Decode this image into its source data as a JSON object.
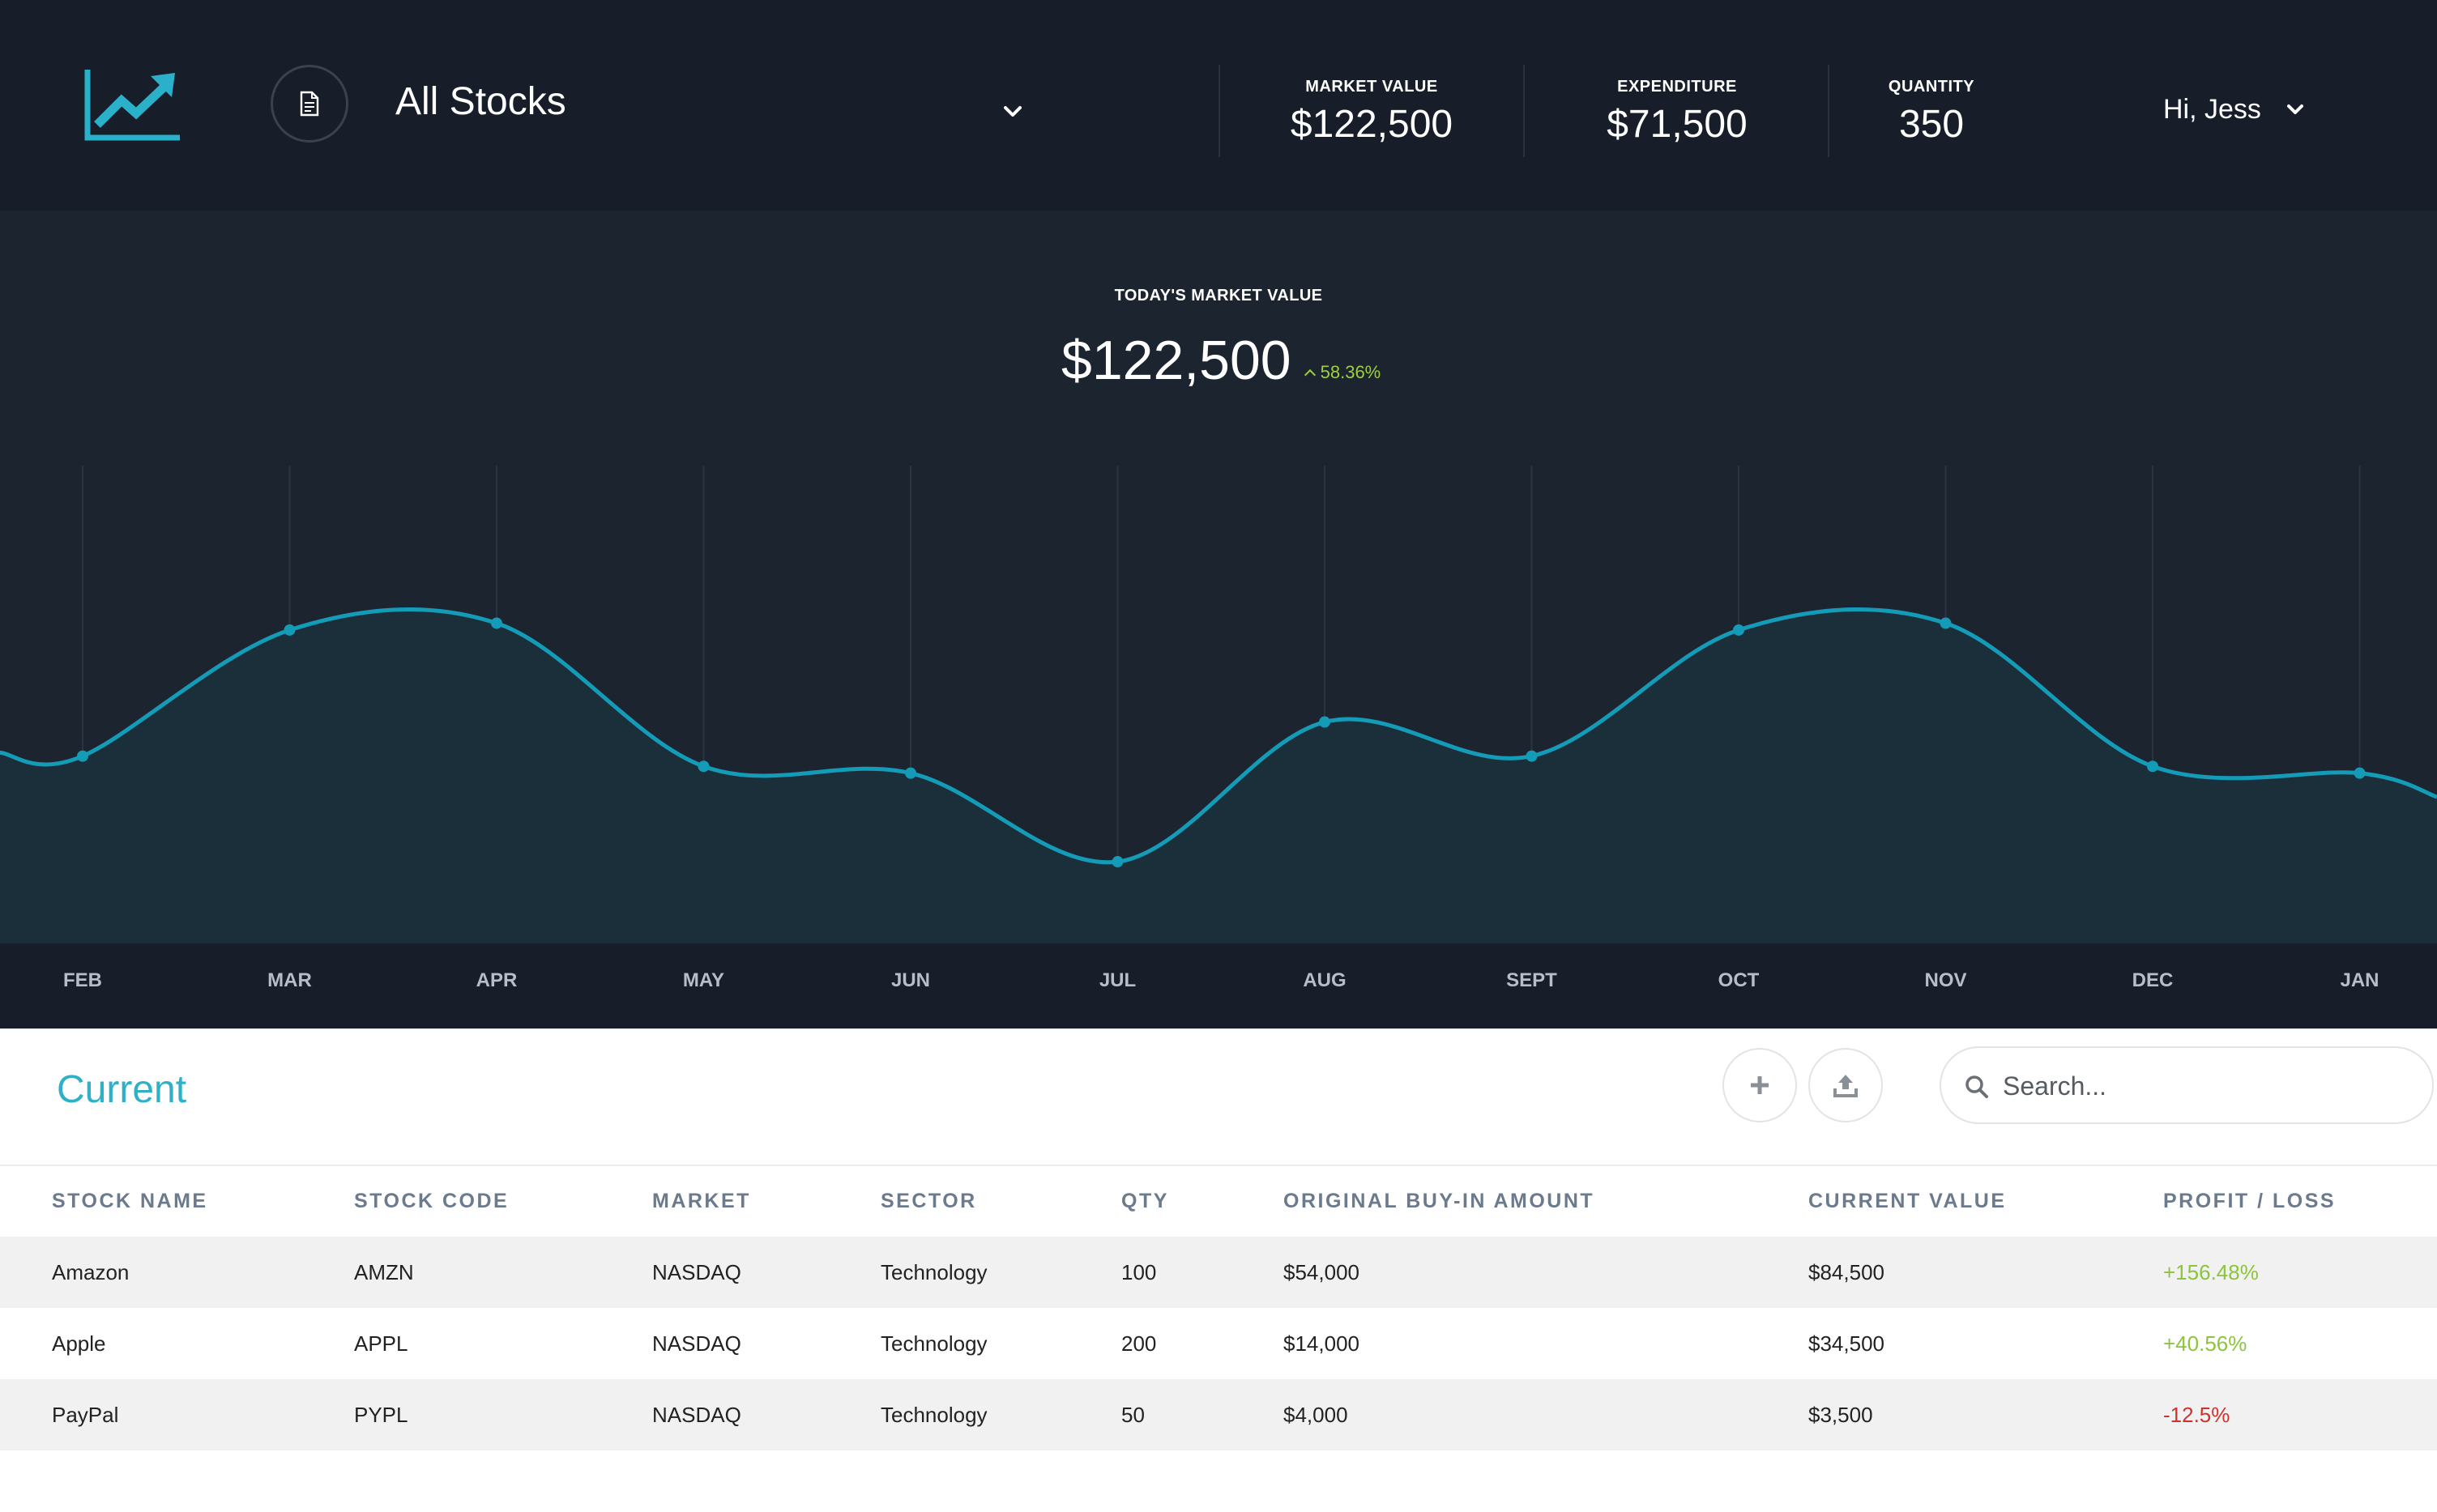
{
  "header": {
    "portfolio_title": "All Stocks",
    "stats": [
      {
        "label": "MARKET VALUE",
        "value": "$122,500"
      },
      {
        "label": "EXPENDITURE",
        "value": "$71,500"
      },
      {
        "label": "QUANTITY",
        "value": "350"
      }
    ],
    "user_greeting": "Hi, Jess",
    "icons": {
      "logo": "trending-up-chart-icon",
      "portfolio": "document-icon",
      "dropdown": "chevron-down-icon"
    }
  },
  "summary": {
    "label": "TODAY'S MARKET VALUE",
    "value": "$122,500",
    "change": "58.36%",
    "change_direction": "up",
    "change_color": "#9ed03b"
  },
  "chart_data": {
    "type": "area",
    "categories": [
      "FEB",
      "MAR",
      "APR",
      "MAY",
      "JUN",
      "JUL",
      "AUG",
      "SEPT",
      "OCT",
      "NOV",
      "DEC",
      "JAN"
    ],
    "values": [
      55,
      92,
      94,
      52,
      50,
      24,
      65,
      55,
      92,
      94,
      52,
      50
    ],
    "ylim": [
      0,
      145
    ],
    "grid": "vertical",
    "line_color": "#139bb7",
    "fill_color": "#1a2f3a",
    "title": "",
    "xlabel": "",
    "ylabel": ""
  },
  "table_section": {
    "title": "Current",
    "search_placeholder": "Search...",
    "icons": {
      "add": "plus-icon",
      "upload": "upload-icon",
      "search": "search-icon"
    }
  },
  "table": {
    "columns": [
      "STOCK NAME",
      "STOCK CODE",
      "MARKET",
      "SECTOR",
      "QTY",
      "ORIGINAL BUY-IN AMOUNT",
      "CURRENT VALUE",
      "PROFIT / LOSS"
    ],
    "rows": [
      {
        "name": "Amazon",
        "code": "AMZN",
        "market": "NASDAQ",
        "sector": "Technology",
        "qty": "100",
        "buy_in": "$54,000",
        "current": "$84,500",
        "pl": "+156.48%",
        "pl_sign": "positive"
      },
      {
        "name": "Apple",
        "code": "APPL",
        "market": "NASDAQ",
        "sector": "Technology",
        "qty": "200",
        "buy_in": "$14,000",
        "current": "$34,500",
        "pl": "+40.56%",
        "pl_sign": "positive"
      },
      {
        "name": "PayPal",
        "code": "PYPL",
        "market": "NASDAQ",
        "sector": "Technology",
        "qty": "50",
        "buy_in": "$4,000",
        "current": "$3,500",
        "pl": "-12.5%",
        "pl_sign": "negative"
      }
    ]
  },
  "colors": {
    "header_bg": "#171e29",
    "chart_bg": "#1c2430",
    "accent": "#2fb0c8",
    "positive": "#8cc43c",
    "negative": "#d0312d"
  }
}
